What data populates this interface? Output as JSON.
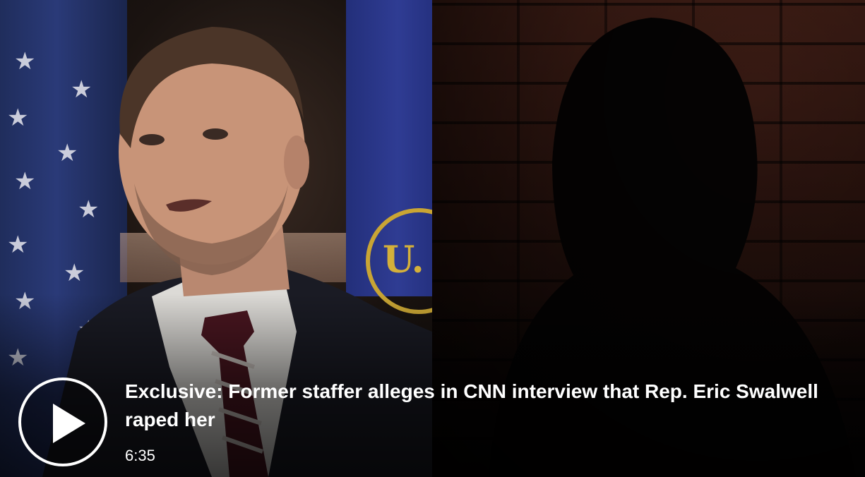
{
  "video": {
    "headline": "Exclusive: Former staffer alleges in CNN interview that Rep. Eric Swalwell raped her",
    "duration": "6:35",
    "play_icon": "play-icon"
  },
  "colors": {
    "overlay_text": "#ffffff",
    "play_ring": "#ffffff",
    "background": "#000000"
  }
}
